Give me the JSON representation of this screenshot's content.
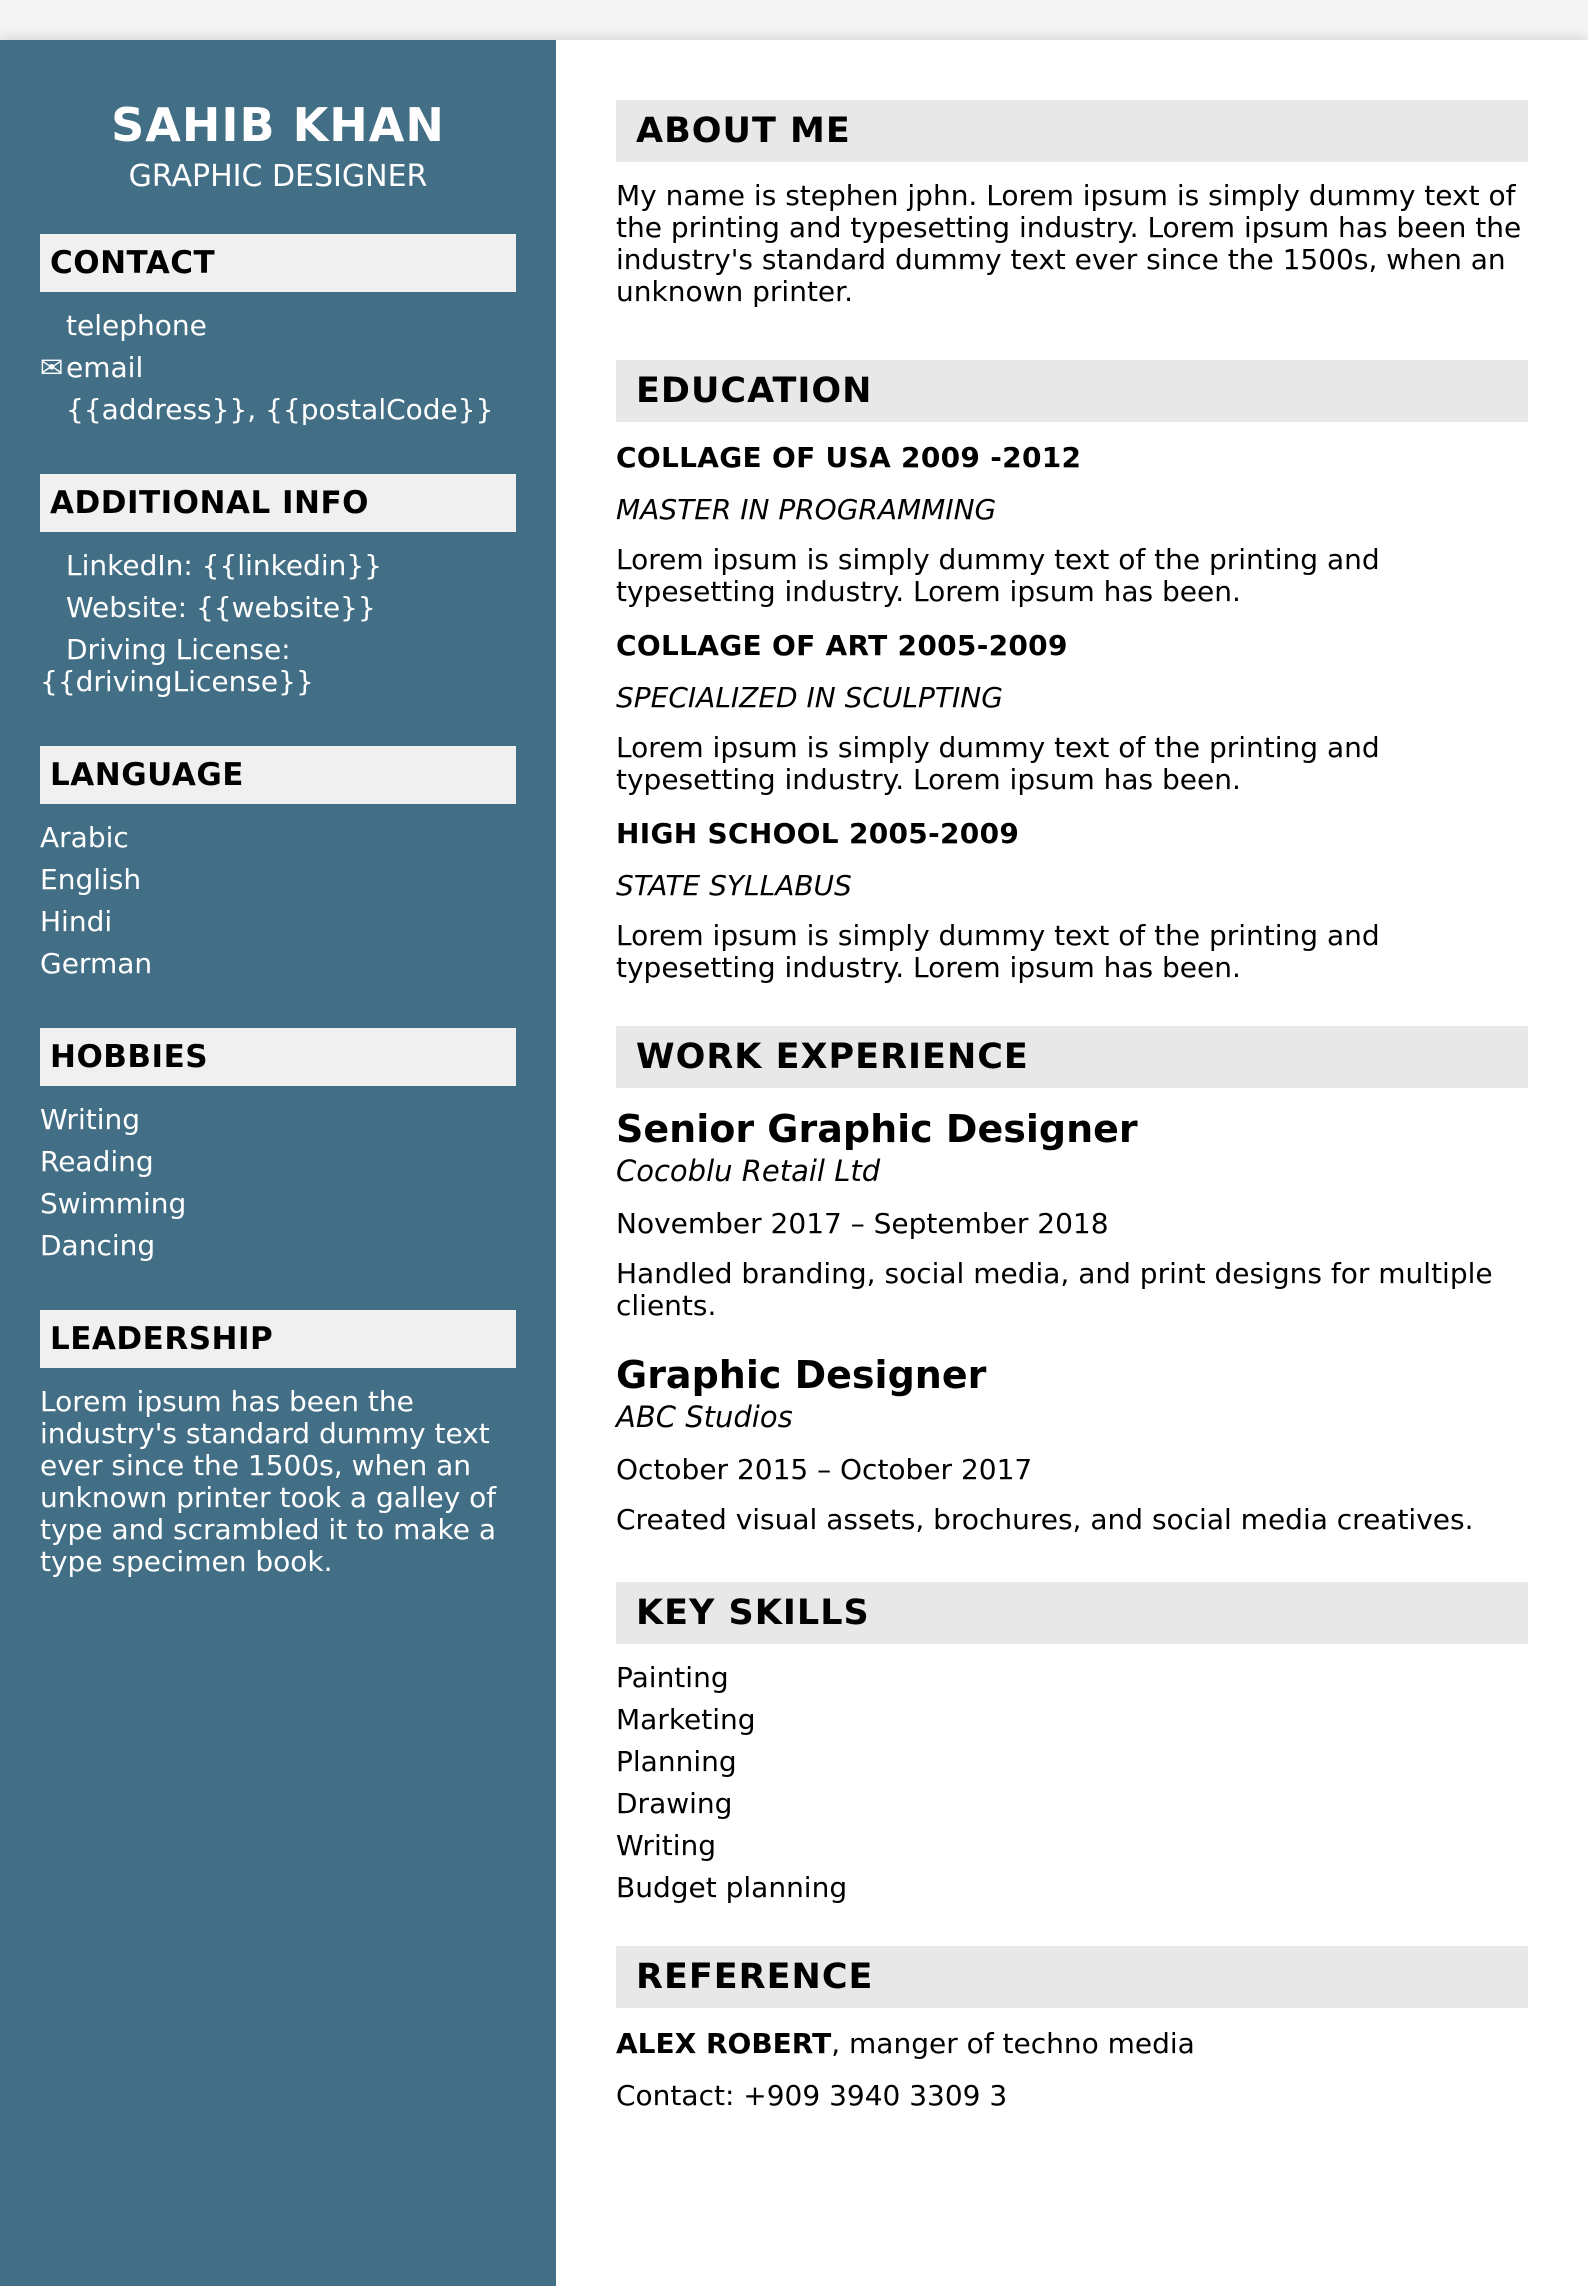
{
  "sidebar": {
    "name": "SAHIB KHAN",
    "role": "GRAPHIC DESIGNER",
    "contact": {
      "heading": "CONTACT",
      "items": [
        {
          "icon": "phone-icon",
          "glyph": "",
          "text": "telephone"
        },
        {
          "icon": "email-icon",
          "glyph": "✉",
          "text": "email"
        },
        {
          "icon": "location-icon",
          "glyph": "",
          "text": "{{address}}, {{postalCode}}"
        }
      ]
    },
    "additional": {
      "heading": "ADDITIONAL INFO",
      "items": [
        {
          "icon": "linkedin-icon",
          "glyph": "",
          "text": "LinkedIn: {{linkedin}}"
        },
        {
          "icon": "globe-icon",
          "glyph": "",
          "text": "Website: {{website}}"
        },
        {
          "icon": "car-icon",
          "glyph": "",
          "text": "Driving License: {{drivingLicense}}"
        }
      ]
    },
    "language": {
      "heading": "LANGUAGE",
      "items": [
        "Arabic",
        "English",
        "Hindi",
        "German"
      ]
    },
    "hobbies": {
      "heading": "HOBBIES",
      "items": [
        "Writing",
        "Reading",
        "Swimming",
        "Dancing"
      ]
    },
    "leadership": {
      "heading": "LEADERSHIP",
      "text": "Lorem ipsum has been the industry's standard dummy text ever since the 1500s, when an unknown printer took a galley of type and scrambled it to make a type specimen book."
    }
  },
  "main": {
    "about": {
      "heading": "ABOUT ME",
      "text": "My name is stephen jphn. Lorem ipsum is simply dummy text of the printing and typesetting industry. Lorem ipsum has been the industry's standard dummy text ever since the 1500s, when an unknown printer."
    },
    "education": {
      "heading": "EDUCATION",
      "items": [
        {
          "title": "COLLAGE OF USA 2009 -2012",
          "subtitle": "MASTER IN PROGRAMMING",
          "desc": "Lorem ipsum is simply dummy text of the printing and typesetting industry. Lorem ipsum has been."
        },
        {
          "title": "COLLAGE OF ART 2005-2009",
          "subtitle": "SPECIALIZED IN SCULPTING",
          "desc": "Lorem ipsum is simply dummy text of the printing and typesetting industry. Lorem ipsum has been."
        },
        {
          "title": "HIGH SCHOOL 2005-2009",
          "subtitle": "STATE SYLLABUS",
          "desc": "Lorem ipsum is simply dummy text of the printing and typesetting industry. Lorem ipsum has been."
        }
      ]
    },
    "work": {
      "heading": "WORK EXPERIENCE",
      "items": [
        {
          "title": "Senior Graphic Designer",
          "company": "Cocoblu Retail Ltd",
          "dates": "November 2017 – September 2018",
          "desc": "Handled branding, social media, and print designs for multiple clients."
        },
        {
          "title": "Graphic Designer",
          "company": "ABC Studios",
          "dates": "October 2015 – October 2017",
          "desc": "Created visual assets, brochures, and social media creatives."
        }
      ]
    },
    "skills": {
      "heading": "KEY SKILLS",
      "items": [
        "Painting",
        "Marketing",
        "Planning",
        "Drawing",
        "Writing",
        "Budget planning"
      ]
    },
    "reference": {
      "heading": "REFERENCE",
      "name": "ALEX ROBERT",
      "position": ", manger of techno media",
      "contact": "Contact: +909 3940 3309 3"
    }
  }
}
